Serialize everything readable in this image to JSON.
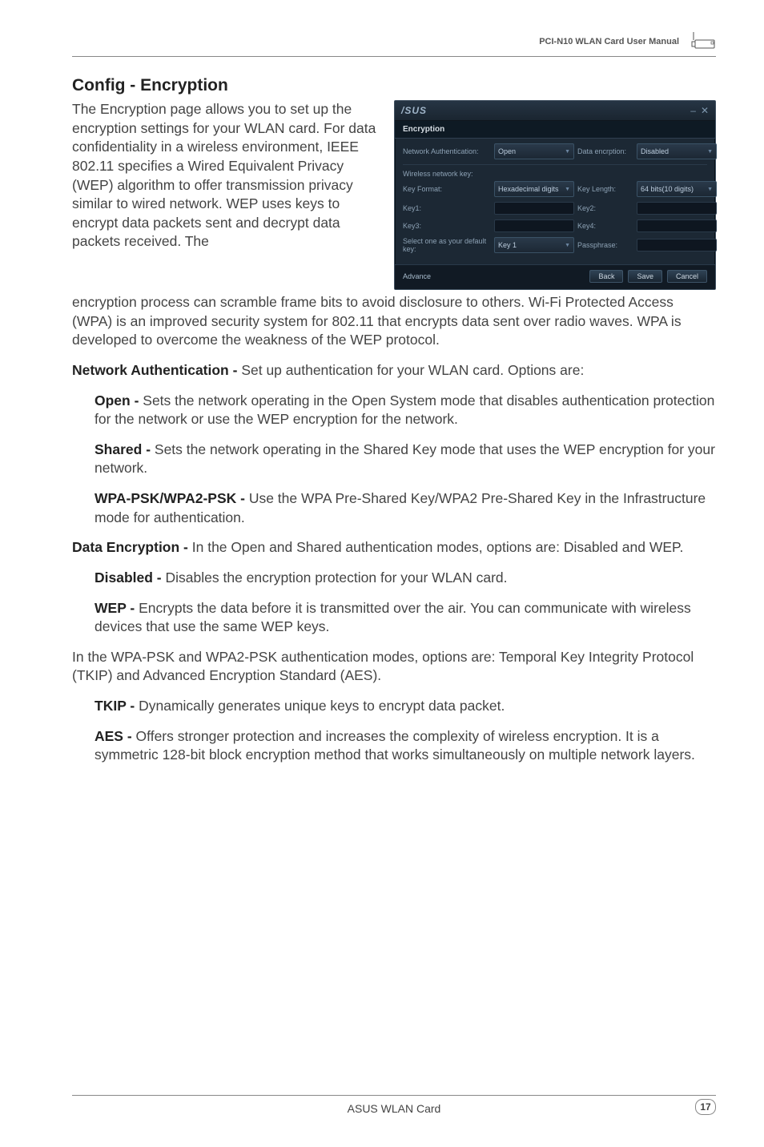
{
  "header": {
    "title": "PCI-N10 WLAN Card User Manual"
  },
  "section_heading": "Config - Encryption",
  "intro_para": "The Encryption page allows you to set up the encryption settings for your WLAN card. For data confidentiality in a wireless environment, IEEE 802.11 specifies a Wired Equivalent Privacy (WEP) algorithm to offer transmission privacy similar to wired network. WEP uses keys to encrypt data packets sent and decrypt data packets received. The encryption process can scramble frame bits to avoid disclosure to others. Wi-Fi Protected Access (WPA) is an improved security system for 802.11 that encrypts data sent over radio waves. WPA is developed to overcome the weakness of the WEP protocol.",
  "dialog": {
    "brand": "/SUS",
    "tab": "Encryption",
    "net_auth_label": "Network Authentication:",
    "net_auth_value": "Open",
    "data_enc_label": "Data encrption:",
    "data_enc_value": "Disabled",
    "wnk_label": "Wireless network key:",
    "key_format_label": "Key Format:",
    "key_format_value": "Hexadecimal digits",
    "key_length_label": "Key Length:",
    "key_length_value": "64 bits(10 digits)",
    "key1_label": "Key1:",
    "key2_label": "Key2:",
    "key3_label": "Key3:",
    "key4_label": "Key4:",
    "select_default_label": "Select one as your default key:",
    "select_default_value": "Key 1",
    "passphrase_label": "Passphrase:",
    "advance": "Advance",
    "back": "Back",
    "save": "Save",
    "cancel": "Cancel"
  },
  "net_auth": {
    "lead": "Network Authentication - ",
    "tail": "Set up authentication for your WLAN card. Options are:",
    "open_lead": "Open - ",
    "open_tail": "Sets the network operating in the Open System mode that disables authentication protection for the network or use the WEP encryption for the network.",
    "shared_lead": "Shared - ",
    "shared_tail": "Sets the network operating in the Shared Key mode that uses the WEP encryption for your network.",
    "wpa_lead": "WPA-PSK/WPA2-PSK - ",
    "wpa_tail": "Use the WPA Pre-Shared Key/WPA2 Pre-Shared Key in the Infrastructure mode for authentication."
  },
  "data_enc": {
    "lead": "Data Encryption - ",
    "tail": "In the Open and Shared authentication modes, options are: Disabled and WEP.",
    "disabled_lead": "Disabled - ",
    "disabled_tail": "Disables the encryption protection for your WLAN card.",
    "wep_lead": "WEP - ",
    "wep_tail": "Encrypts the data before it is transmitted over the air. You can communicate with wireless devices that use the same WEP keys."
  },
  "wpa_modes": "In the WPA-PSK and WPA2-PSK authentication modes, options are: Temporal Key Integrity Protocol (TKIP) and Advanced Encryption Standard (AES).",
  "tkip_lead": "TKIP - ",
  "tkip_tail": "Dynamically generates unique keys to encrypt data packet.",
  "aes_lead": "AES - ",
  "aes_tail": "Offers stronger protection and increases the complexity of wireless encryption. It is a symmetric 128-bit block encryption method that works simultaneously on multiple network layers.",
  "footer": {
    "center": "ASUS WLAN Card",
    "page": "17"
  }
}
